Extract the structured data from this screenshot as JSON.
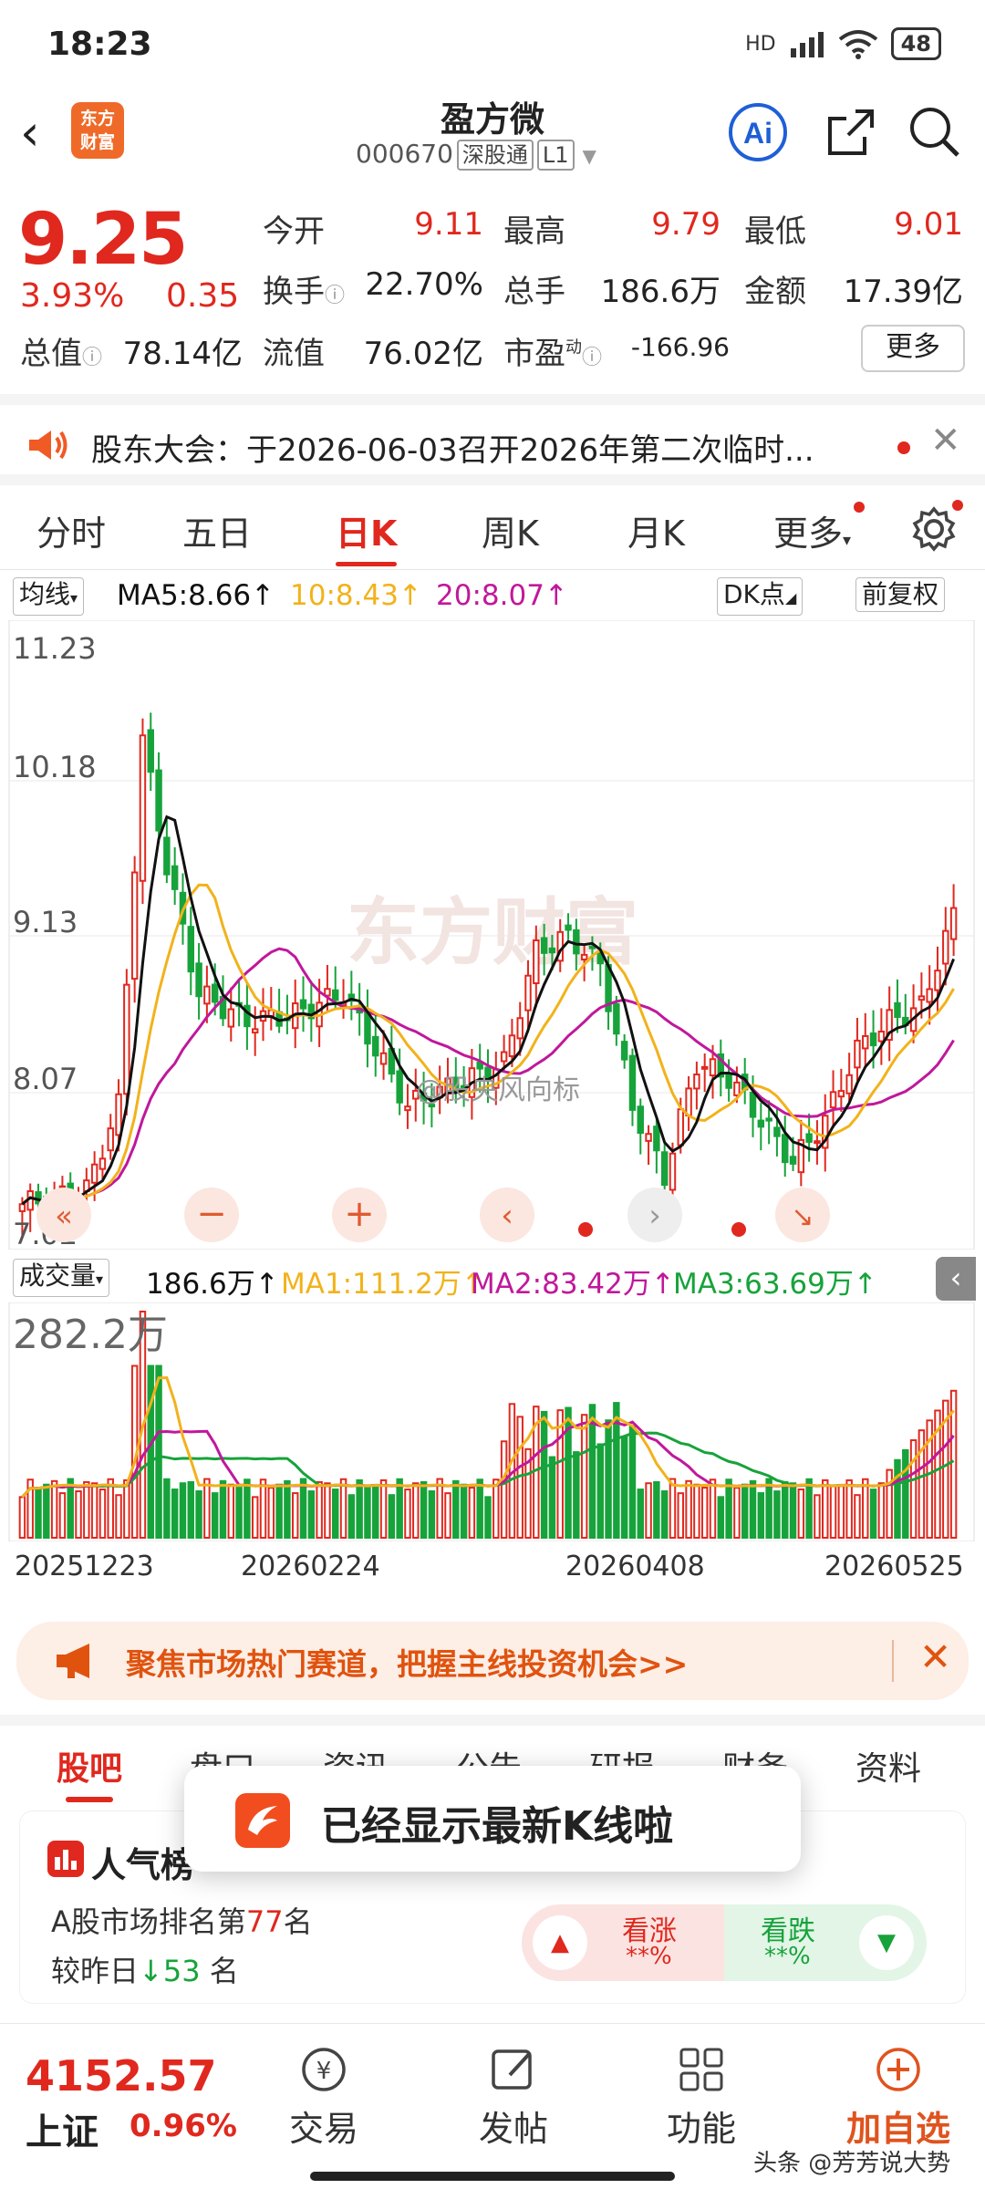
{
  "status_bar": {
    "time": "18:23",
    "network": "HD",
    "battery": "48"
  },
  "header": {
    "logo_text_1": "东方",
    "logo_text_2": "财富",
    "stock_name": "盈方微",
    "stock_code": "000670",
    "tag1": "深股通",
    "tag2": "L1",
    "ai_label": "Ai"
  },
  "quote": {
    "price": "9.25",
    "change_pct": "3.93%",
    "change": "0.35",
    "stats": [
      {
        "label": "今开",
        "value": "9.11",
        "color": "red"
      },
      {
        "label": "最高",
        "value": "9.79",
        "color": "red"
      },
      {
        "label": "最低",
        "value": "9.01",
        "color": "red"
      },
      {
        "label": "换手",
        "value": "22.70%",
        "color": "dark"
      },
      {
        "label": "总手",
        "value": "186.6万",
        "color": "dark"
      },
      {
        "label": "金额",
        "value": "17.39亿",
        "color": "dark"
      },
      {
        "label": "总值",
        "value": "78.14亿",
        "color": "dark"
      },
      {
        "label": "流值",
        "value": "76.02亿",
        "color": "dark"
      },
      {
        "label": "市盈",
        "value": "-166.96",
        "color": "dark"
      }
    ],
    "pe_sup": "动",
    "more_label": "更多"
  },
  "notice": {
    "text": "股东大会：于2026-06-03召开2026年第二次临时..."
  },
  "period_tabs": [
    "分时",
    "五日",
    "日K",
    "周K",
    "月K",
    "更多"
  ],
  "active_period": "日K",
  "ma_legend": {
    "selector": "均线",
    "ma5": "MA5:8.66↑",
    "ma10": "10:8.43↑",
    "ma20": "20:8.07↑",
    "dk": "DK点",
    "adjust": "前复权"
  },
  "colors": {
    "up": "#e0281e",
    "down": "#17a33b",
    "ma5": "#111111",
    "ma10": "#f2b21b",
    "ma20": "#c0189b",
    "brand": "#ef6a28"
  },
  "chart_data": [
    {
      "type": "candlestick",
      "y_ticks": [
        "11.23",
        "10.18",
        "9.13",
        "8.07",
        "7.02"
      ],
      "ylim": [
        7.02,
        11.23
      ],
      "watermark": "东方财富",
      "overlay_text": "@股央风向标"
    },
    {
      "type": "bar",
      "title": "成交量",
      "volume": "186.6万↑",
      "ma1": "MA1:111.2万↑",
      "ma2": "MA2:83.42万↑",
      "ma3": "MA3:63.69万↑",
      "y_tick": "282.2万",
      "x_ticks": [
        "20251223",
        "20260224",
        "20260408",
        "20260525"
      ]
    }
  ],
  "banner": {
    "text": "聚焦市场热门赛道，把握主线投资机会>>"
  },
  "bottom_tabs": [
    "股吧",
    "盘口",
    "资讯",
    "公告",
    "研报",
    "财务",
    "资料"
  ],
  "popularity": {
    "title": "人气榜",
    "rank_line_prefix": "A股市场排名第",
    "rank": "77",
    "rank_suffix": "名",
    "compare_prefix": "较昨日",
    "compare_value": "53",
    "compare_suffix": "名",
    "up_label": "看涨",
    "up_pct": "**%",
    "down_label": "看跌",
    "down_pct": "**%"
  },
  "toast": {
    "text": "已经显示最新K线啦"
  },
  "bottom_bar": {
    "index_value": "4152.57",
    "index_name": "上证",
    "index_pct": "0.96%",
    "nav": [
      "交易",
      "发帖",
      "功能",
      "加自选"
    ],
    "watermark": "头条 @芳芳说大势"
  }
}
